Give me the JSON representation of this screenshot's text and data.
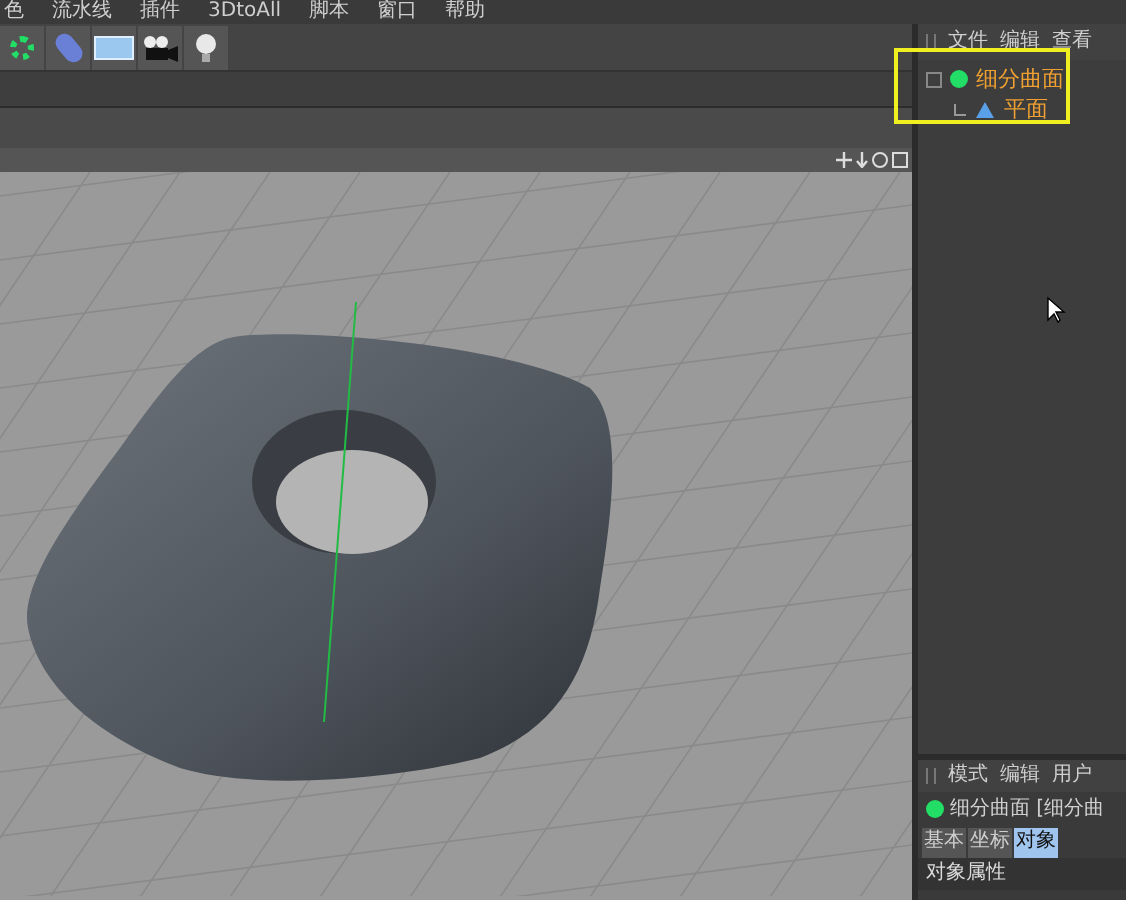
{
  "menu_bar": [
    "色",
    "流水线",
    "插件",
    "3DtoAll",
    "脚本",
    "窗口",
    "帮助"
  ],
  "object_manager": {
    "menu": [
      "文件",
      "编辑",
      "查看"
    ],
    "tree": [
      {
        "name": "细分曲面",
        "kind": "subdivision",
        "children": [
          {
            "name": "平面",
            "kind": "plane"
          }
        ]
      }
    ]
  },
  "attribute_manager": {
    "menu": [
      "模式",
      "编辑",
      "用户"
    ],
    "object_title": "细分曲面 [细分曲",
    "tabs": [
      {
        "label": "基本",
        "selected": false
      },
      {
        "label": "坐标",
        "selected": false
      },
      {
        "label": "对象",
        "selected": true
      }
    ],
    "section": "对象属性"
  }
}
